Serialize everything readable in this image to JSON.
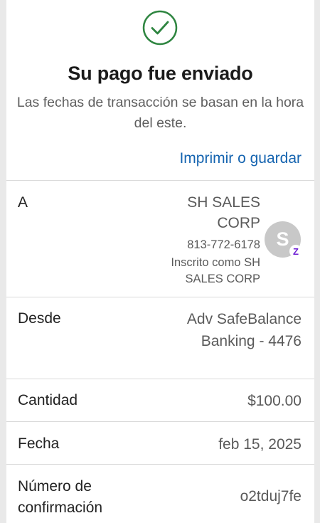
{
  "header": {
    "title": "Su pago fue enviado",
    "subtitle": "Las fechas de transacción se basan en la hora del este.",
    "print_label": "Imprimir o guardar",
    "check_color": "#2e8540",
    "icon": "check-circle-icon"
  },
  "recipient": {
    "label": "A",
    "name_line1": "SH SALES",
    "name_line2": "CORP",
    "phone": "813-772-6178",
    "enrolled_line1": "Inscrito como SH",
    "enrolled_line2": "SALES CORP",
    "avatar_initial": "S",
    "badge_glyph": "Z",
    "badge_color": "#6d1ed4",
    "badge_icon": "zelle-icon"
  },
  "from": {
    "label": "Desde",
    "line1": "Adv SafeBalance",
    "line2": "Banking - 4476"
  },
  "amount": {
    "label": "Cantidad",
    "value": "$100.00"
  },
  "date": {
    "label": "Fecha",
    "value": "feb 15, 2025"
  },
  "confirmation": {
    "label_line1": "Número de",
    "label_line2": "confirmación",
    "value": "o2tduj7fe"
  },
  "colors": {
    "link": "#1564b0",
    "background": "#e9e9e9",
    "card": "#ffffff"
  }
}
